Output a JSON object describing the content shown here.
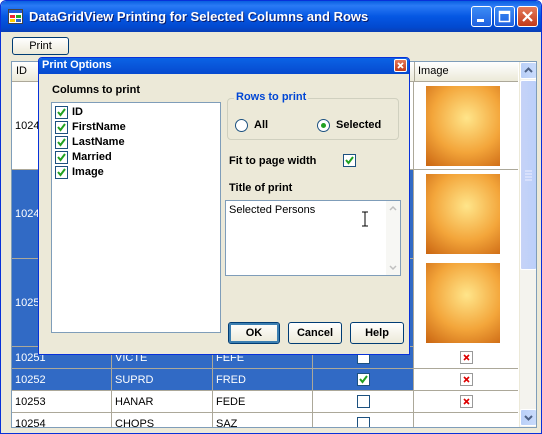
{
  "window": {
    "title": "DataGridView Printing for Selected Columns and Rows",
    "icons": {
      "app": "app-window-icon",
      "minimize": "minimize-icon",
      "maximize": "maximize-icon",
      "close": "close-icon"
    }
  },
  "toolbar": {
    "print_label": "Print"
  },
  "grid": {
    "headers": {
      "id": "ID",
      "image": "Image"
    },
    "rows": [
      {
        "id": "1024",
        "selected": false
      },
      {
        "id": "1024",
        "selected": true
      },
      {
        "id": "1025",
        "selected": true
      },
      {
        "id": "10251",
        "customer": "VICTE",
        "name": "FEFE",
        "married": true,
        "selected": true
      },
      {
        "id": "10252",
        "customer": "SUPRD",
        "name": "FRED",
        "married": true,
        "selected": true
      },
      {
        "id": "10253",
        "customer": "HANAR",
        "name": "FEDE",
        "married": false,
        "selected": false
      },
      {
        "id": "10254",
        "customer": "CHOPS",
        "name": "SAZ",
        "married": false,
        "selected": false
      }
    ]
  },
  "dialog": {
    "title": "Print Options",
    "columns_label": "Columns to print",
    "columns": [
      {
        "label": "ID",
        "checked": true
      },
      {
        "label": "FirstName",
        "checked": true
      },
      {
        "label": "LastName",
        "checked": true
      },
      {
        "label": "Married",
        "checked": true
      },
      {
        "label": "Image",
        "checked": true
      }
    ],
    "rows_group_label": "Rows to print",
    "rows_all_label": "All",
    "rows_selected_label": "Selected",
    "rows_selected_value": "Selected",
    "fit_label": "Fit to page width",
    "fit_checked": true,
    "title_label": "Title of print",
    "title_value": "Selected Persons",
    "ok_label": "OK",
    "cancel_label": "Cancel",
    "help_label": "Help"
  },
  "colors": {
    "title_blue": "#0557e3",
    "selection": "#316ac5",
    "group_title": "#0046d5",
    "window_bg": "#ece9d8"
  }
}
